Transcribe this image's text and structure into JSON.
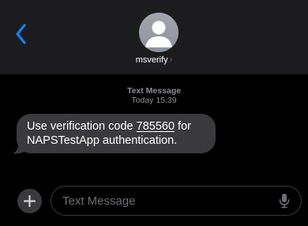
{
  "header": {
    "contact_name": "msverify",
    "contact_chevron": "›",
    "back_icon": "chevron-left-icon",
    "avatar_icon": "person-silhouette-icon"
  },
  "conversation": {
    "timestamp_kind": "Text Message",
    "timestamp_time": "Today 15:39",
    "messages": [
      {
        "direction": "incoming",
        "text_before_code": "Use verification code ",
        "code": "785560",
        "text_after_code": " for NAPSTestApp authentication."
      }
    ]
  },
  "input_bar": {
    "plus_icon": "plus-icon",
    "placeholder": "Text Message",
    "value": "",
    "mic_icon": "microphone-icon"
  },
  "colors": {
    "background": "#000000",
    "header": "#1c1c1e",
    "accent": "#0a84ff",
    "bubble_incoming": "#3a3a3c",
    "secondary_text": "#8e8e93"
  }
}
